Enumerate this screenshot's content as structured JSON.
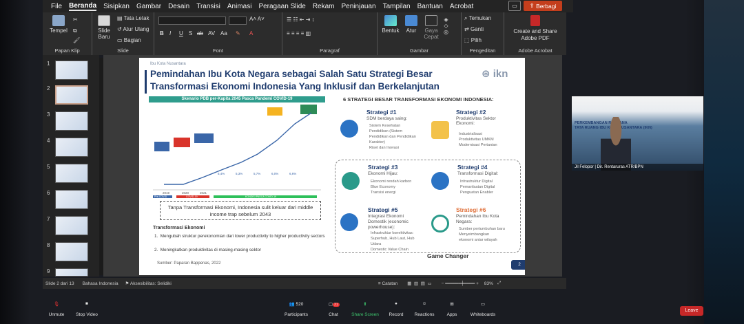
{
  "menu": {
    "items": [
      "File",
      "Beranda",
      "Sisipkan",
      "Gambar",
      "Desain",
      "Transisi",
      "Animasi",
      "Peragaan Slide",
      "Rekam",
      "Peninjauan",
      "Tampilan",
      "Bantuan",
      "Acrobat"
    ],
    "share": "Berbagi"
  },
  "ribbon": {
    "tempel": "Tempel",
    "slide_baru": "Slide Baru",
    "tata_letak": "Tata Letak",
    "atur_ulang": "Atur Ulang",
    "bagian": "Bagian",
    "bentuk": "Bentuk",
    "atur": "Atur",
    "gaya_cepat": "Gaya Cepat",
    "temukan": "Temukan",
    "ganti": "Ganti",
    "pilih": "Pilih",
    "create_share": "Create and Share Adobe PDF",
    "groups": [
      "Papan Klip",
      "Slide",
      "Font",
      "Paragraf",
      "Gambar",
      "Pengeditan",
      "Adobe Acrobat"
    ],
    "font_btns": [
      "B",
      "I",
      "U",
      "S",
      "ab",
      "AV",
      "Aa"
    ]
  },
  "thumbs": [
    "1",
    "2",
    "3",
    "4",
    "5",
    "6",
    "7",
    "8",
    "9"
  ],
  "slide": {
    "kicker": "Ibu Kota Nusantara",
    "title1": "Pemindahan Ibu Kota Negara sebagai Salah Satu Strategi Besar",
    "title2": "Transformasi Ekonomi Indonesia Yang Inklusif dan Berkelanjutan",
    "logo": "ikn",
    "chart_head": "Skenario PDB per-Kapita 2045 Pasca Pandemi COVID-19",
    "chart": {
      "years": [
        "2019",
        "2020",
        "2021"
      ],
      "growth": [
        "5,4%",
        "5,3%",
        "5,7%",
        "6,0%",
        "6,6%"
      ],
      "pre": "Pre-COVID",
      "covid": "COVID-19",
      "after": "KONDISI PASCA COVID-19"
    },
    "note": "Tanpa Transformasi Ekonomi, Indonesia sulit keluar dari middle income trap sebelum 2043",
    "tf_head": "Transformasi Ekonomi",
    "tf1": "Mengubah struktur perekonomian dari lower productivity to higher productivity sectors",
    "tf2": "Meningkatkan produktivitas di masing-masing sektor",
    "source": "Sumber: Paparan Bappenas, 2022",
    "right_head": "6 STRATEGI BESAR TRANSFORMASI EKONOMI INDONESIA:",
    "s1_title": "Strategi #1",
    "s1_sub": "SDM berdaya saing:",
    "s1_b": [
      "Sistem Kesehatan",
      "Pendidikan (Sistem",
      "Pendidikan dan Pendidikan",
      "Karakter)",
      "Riset dan Inovasi"
    ],
    "s2_title": "Strategi #2",
    "s2_sub": "Produktivitas Sektor Ekonomi:",
    "s2_b": [
      "Industrialisasi",
      "Produktivitas UMKM",
      "Modernisasi Pertanian"
    ],
    "s3_title": "Strategi #3",
    "s3_sub": "Ekonomi Hijau:",
    "s3_b": [
      "Ekonomi rendah karbon",
      "Blue Economy",
      "Transisi energi"
    ],
    "s4_title": "Strategi #4",
    "s4_sub": "Transformasi Digital:",
    "s4_b": [
      "Infrastruktur Digital",
      "Pemanfaatan Digital",
      "Penguatan Enabler"
    ],
    "s5_title": "Strategi #5",
    "s5_sub": "Integrasi Ekonomi Domestik (economic powerhouse):",
    "s5_b": [
      "Infrastruktur konektivitas:",
      "Superhub, Hub Laut, Hub",
      "Udara",
      "Domestic Value Chain"
    ],
    "s6_title": "Strategi #6",
    "s6_sub": "Pemindahan Ibu Kota Negara:",
    "s6_b": [
      "Sumber pertumbuhan baru",
      "Menyeimbangkan",
      "ekonomi antar wilayah"
    ],
    "game_changer": "Game Changer",
    "page_num": "2"
  },
  "status": {
    "slide": "Slide 2 dari 13",
    "lang": "Bahasa Indonesia",
    "access": "Aksesibilitas: Selidiki",
    "catatan": "Catatan",
    "zoom": "83%"
  },
  "zoom": {
    "unmute": "Unmute",
    "stop_video": "Stop Video",
    "participants": "Participants",
    "participants_count": "520",
    "chat": "Chat",
    "chat_badge": "21",
    "share_screen": "Share Screen",
    "record": "Record",
    "reactions": "Reactions",
    "apps": "Apps",
    "whiteboards": "Whiteboards",
    "leave": "Leave"
  },
  "cam": {
    "label": "Jil Felopor | Dir. Rentaruras ATR/BPN",
    "t1": "PERKEMBANGAN RENCANA",
    "t2": "TATA RUANG IBU KOTA NUSANTARA (IKN)"
  },
  "colors": {
    "accent": "#c43e1c",
    "title": "#1f3c6e",
    "teal": "#2f9d8d",
    "leave": "#c62828"
  }
}
